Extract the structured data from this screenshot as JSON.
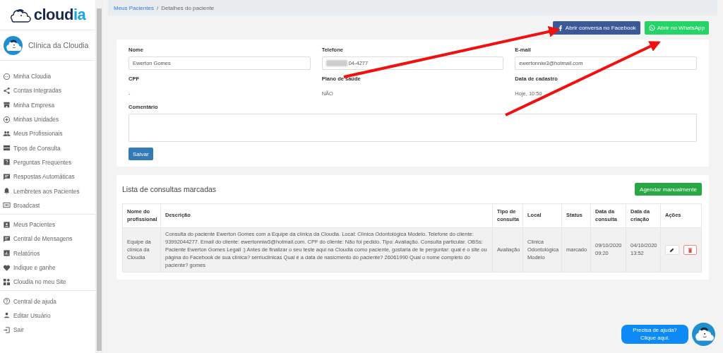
{
  "sidebar": {
    "logo": {
      "text_dark": "cloud",
      "text_light": "ia"
    },
    "clinic": "Clínica da Cloudia",
    "groups": [
      {
        "items": [
          {
            "label": "Minha Cloudia"
          },
          {
            "label": "Contas Integradas"
          },
          {
            "label": "Minha Empresa"
          },
          {
            "label": "Minhas Unidades"
          },
          {
            "label": "Meus Profissionais"
          },
          {
            "label": "Tipos de Consulta"
          },
          {
            "label": "Perguntas Frequentes"
          },
          {
            "label": "Respostas Automáticas"
          },
          {
            "label": "Lembretes aos Pacientes"
          },
          {
            "label": "Broadcast"
          }
        ]
      },
      {
        "items": [
          {
            "label": "Meus Pacientes"
          },
          {
            "label": "Central de Mensagens"
          },
          {
            "label": "Relatórios"
          },
          {
            "label": "Indique e ganhe"
          },
          {
            "label": "Cloudia no meu Site"
          }
        ]
      },
      {
        "items": [
          {
            "label": "Central de ajuda"
          },
          {
            "label": "Editar Usuário"
          },
          {
            "label": "Sair"
          }
        ]
      }
    ]
  },
  "breadcrumb": [
    {
      "label": "Meus Pacientes",
      "kind": "link"
    },
    {
      "label": "/",
      "kind": "separator"
    },
    {
      "label": "Detalhes do paciente",
      "kind": "current"
    }
  ],
  "actions": [
    {
      "label": "Abrir conversa no Facebook",
      "kind": "facebook"
    },
    {
      "label": "Abrir no WhatsApp",
      "kind": "whatsapp"
    }
  ],
  "patient": {
    "fields": [
      {
        "label": "Nome",
        "kind": "input",
        "value": "Ewerton Gomes"
      },
      {
        "label": "Telefone",
        "kind": "input",
        "value": "04-4277",
        "redacted": true
      },
      {
        "label": "E-mail",
        "kind": "input",
        "value": "ewertonniw3@hotmail.com"
      },
      {
        "label": "CPF",
        "kind": "text",
        "value": "-"
      },
      {
        "label": "Plano de saúde",
        "kind": "text",
        "value": "NÃO"
      },
      {
        "label": "Data de cadastro",
        "kind": "text",
        "value": "Hoje, 10:50"
      }
    ],
    "comment_label": "Comentário",
    "save_button": "Salvar"
  },
  "appointments": {
    "title": "Lista de consultas marcadas",
    "add_button": "Agendar manualmente",
    "table": {
      "columns": [
        "Nome do profissional",
        "Descrição",
        "Tipo de consulta",
        "Local",
        "Status",
        "Data da consulta",
        "Data da criação",
        "Ações"
      ],
      "rows": [
        {
          "cells": [
            "Equipe da clínica da Cloudia",
            "Consulta do paciente Ewerton Gomes com a Equipe da clínica da Cloudia. Local: Clínica Odontológica Modelo. Telefone do cliente: 93992044277. Email do cliente: ewertonniw3@hotmail.com. CPF do cliente: Não foi pedido. Tipo: Avaliação. Consulta particular. OBSs: Paciente Ewerton Gomes Legall :) Antes de finalizar o seu teste aqui na Cloudia como paciente, gostaria de te perguntar: qual é o site ou página do Facebook de sua clínica? serriuclinicas Qual é a data de nasicmento do paciente? 26061990 Qual o nome completo do paciente? gomes",
            "Avaliação",
            "Clínica Odontológica Modelo",
            "marcado",
            "09/10/2020 09:20",
            "04/10/2020 13:52"
          ]
        }
      ]
    }
  },
  "help": {
    "text": "Precisa de ajuda? Clique aqui."
  }
}
